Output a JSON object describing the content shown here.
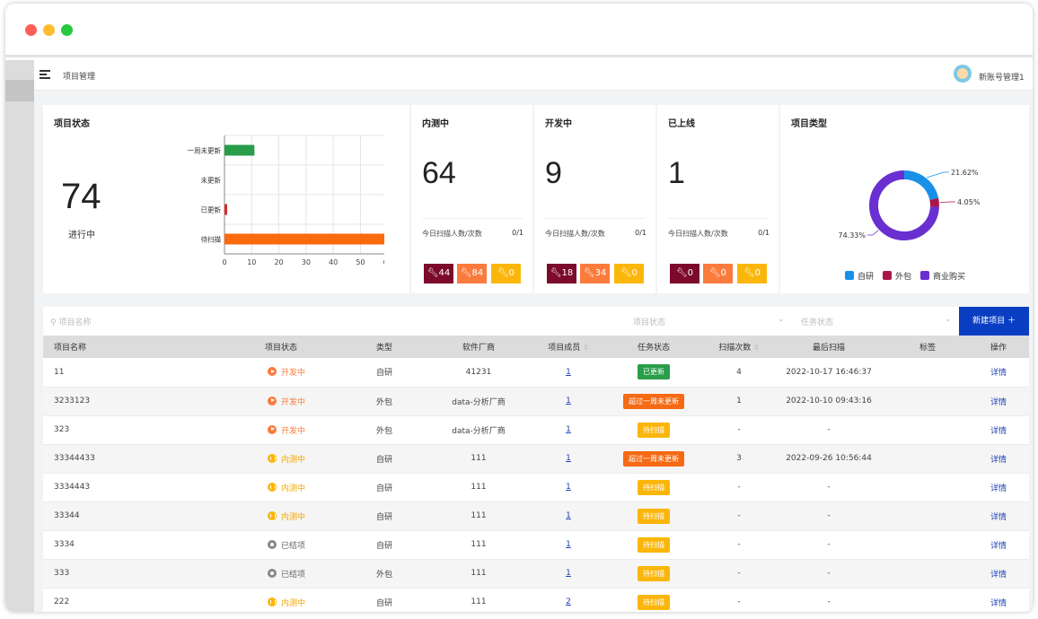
{
  "topbar": {
    "breadcrumb": "项目管理",
    "username": "新账号管理1"
  },
  "project_status": {
    "title": "项目状态",
    "count": "74",
    "count_label": "进行中",
    "chart_data": {
      "type": "bar",
      "orientation": "horizontal",
      "categories": [
        "一周未更新",
        "未更新",
        "已更新",
        "待扫描"
      ],
      "values": [
        11,
        0,
        1,
        62
      ],
      "colors": [
        "#2a9d4a",
        "#2a9d4a",
        "#d0312d",
        "#fb6a0c"
      ],
      "xlim": [
        0,
        70
      ],
      "xticks": [
        0,
        10,
        20,
        30,
        40,
        50,
        60,
        70
      ],
      "grid": true
    }
  },
  "stage_cards": [
    {
      "title": "内测中",
      "count": "64",
      "scan_label": "今日扫描人数/次数",
      "scan_value": "0/1",
      "pills": [
        "44",
        "84",
        "0"
      ]
    },
    {
      "title": "开发中",
      "count": "9",
      "scan_label": "今日扫描人数/次数",
      "scan_value": "0/1",
      "pills": [
        "18",
        "34",
        "0"
      ]
    },
    {
      "title": "已上线",
      "count": "1",
      "scan_label": "今日扫描人数/次数",
      "scan_value": "0/1",
      "pills": [
        "0",
        "0",
        "0"
      ]
    }
  ],
  "pill_icon": "wrench-icon",
  "project_type": {
    "title": "项目类型",
    "chart_data": {
      "type": "pie",
      "donut": true,
      "labels": [
        "自研",
        "外包",
        "商业购买"
      ],
      "values": [
        21.62,
        4.05,
        74.33
      ],
      "value_labels": [
        "21.62%",
        "4.05%",
        "74.33%"
      ],
      "colors": [
        "#1890e8",
        "#a8174a",
        "#6a2fd0"
      ],
      "legend": "bottom"
    }
  },
  "filters": {
    "search_placeholder": "项目名称",
    "project_status_placeholder": "项目状态",
    "task_status_placeholder": "任务状态",
    "new_button": "新建项目 ＋"
  },
  "table": {
    "headers": [
      "项目名称",
      "项目状态",
      "类型",
      "软件厂商",
      "项目成员",
      "任务状态",
      "扫描次数",
      "最后扫描",
      "标签",
      "操作"
    ],
    "sort_glyph": "⇕",
    "rows": [
      {
        "name": "11",
        "status": "开发中",
        "status_kind": "dev",
        "type": "自研",
        "vendor": "41231",
        "members": "1",
        "task": "已更新",
        "task_kind": "green",
        "scans": "4",
        "last": "2022-10-17 16:46:37",
        "tag": "",
        "op": "详情"
      },
      {
        "name": "3233123",
        "status": "开发中",
        "status_kind": "dev",
        "type": "外包",
        "vendor": "data-分析厂商",
        "members": "1",
        "task": "超过一周未更新",
        "task_kind": "orange",
        "scans": "1",
        "last": "2022-10-10 09:43:16",
        "tag": "",
        "op": "详情"
      },
      {
        "name": "323",
        "status": "开发中",
        "status_kind": "dev",
        "type": "外包",
        "vendor": "data-分析厂商",
        "members": "1",
        "task": "待扫描",
        "task_kind": "yellow",
        "scans": "-",
        "last": "-",
        "tag": "",
        "op": "详情"
      },
      {
        "name": "33344433",
        "status": "内测中",
        "status_kind": "test",
        "type": "自研",
        "vendor": "111",
        "members": "1",
        "task": "超过一周未更新",
        "task_kind": "orange",
        "scans": "3",
        "last": "2022-09-26 10:56:44",
        "tag": "",
        "op": "详情"
      },
      {
        "name": "3334443",
        "status": "内测中",
        "status_kind": "test",
        "type": "自研",
        "vendor": "111",
        "members": "1",
        "task": "待扫描",
        "task_kind": "yellow",
        "scans": "-",
        "last": "-",
        "tag": "",
        "op": "详情"
      },
      {
        "name": "33344",
        "status": "内测中",
        "status_kind": "test",
        "type": "自研",
        "vendor": "111",
        "members": "1",
        "task": "待扫描",
        "task_kind": "yellow",
        "scans": "-",
        "last": "-",
        "tag": "",
        "op": "详情"
      },
      {
        "name": "3334",
        "status": "已结项",
        "status_kind": "done",
        "type": "自研",
        "vendor": "111",
        "members": "1",
        "task": "待扫描",
        "task_kind": "yellow",
        "scans": "-",
        "last": "-",
        "tag": "",
        "op": "详情"
      },
      {
        "name": "333",
        "status": "已结项",
        "status_kind": "done",
        "type": "外包",
        "vendor": "111",
        "members": "1",
        "task": "待扫描",
        "task_kind": "yellow",
        "scans": "-",
        "last": "-",
        "tag": "",
        "op": "详情"
      },
      {
        "name": "222",
        "status": "内测中",
        "status_kind": "test",
        "type": "自研",
        "vendor": "111",
        "members": "2",
        "task": "待扫描",
        "task_kind": "yellow",
        "scans": "-",
        "last": "-",
        "tag": "",
        "op": "详情"
      }
    ]
  }
}
